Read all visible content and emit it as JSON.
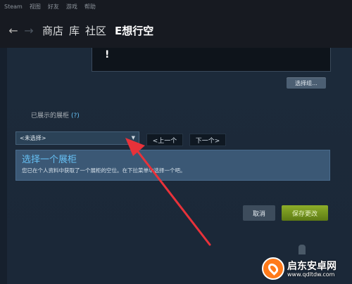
{
  "menubar": {
    "items": [
      "Steam",
      "视图",
      "好友",
      "游戏",
      "帮助"
    ]
  },
  "navbar": {
    "back_icon": "←",
    "forward_icon": "→",
    "links": [
      "商店",
      "库",
      "社区"
    ],
    "username": "E想行空"
  },
  "preview": {
    "glyph": "!"
  },
  "select_button": {
    "label": "选择组..."
  },
  "showcase": {
    "label": "已展示的展柜",
    "help": "(?)",
    "dropdown_value": "<未选择>",
    "prev_label": "<上一个",
    "next_label": "下一个>"
  },
  "info": {
    "title": "选择一个展柜",
    "description": "您已在个人资料中获取了一个展柜的空位。在下拉菜单中选择一个吧。"
  },
  "actions": {
    "cancel_label": "取消",
    "save_label": "保存更改"
  },
  "watermark": {
    "name": "启东安卓网",
    "url": "www.qdltdw.com"
  },
  "colors": {
    "background": "#1b2838",
    "accent_blue": "#66c0f4",
    "save_green": "#7a9b21",
    "annotation_red": "#e8323a"
  }
}
